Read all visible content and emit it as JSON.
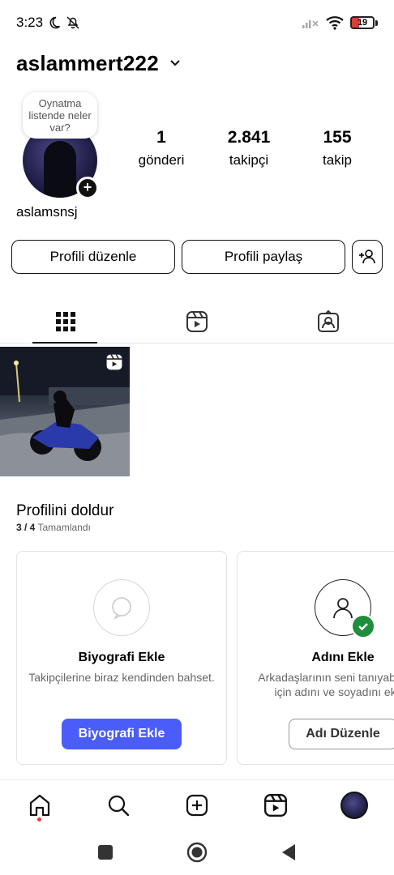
{
  "status_bar": {
    "time": "3:23",
    "battery": "19"
  },
  "header": {
    "username": "aslammert222"
  },
  "profile": {
    "note": "Oynatma listende neler var?",
    "display_name": "aslamsnsj",
    "stats": [
      {
        "value": "1",
        "label": "gönderi"
      },
      {
        "value": "2.841",
        "label": "takipçi"
      },
      {
        "value": "155",
        "label": "takip"
      }
    ]
  },
  "actions": {
    "edit_label": "Profili düzenle",
    "share_label": "Profili paylaş"
  },
  "complete_profile": {
    "title": "Profilini doldur",
    "progress": "3 / 4",
    "progress_label": "Tamamlandı",
    "cards": [
      {
        "title": "Biyografi Ekle",
        "text": "Takipçilerine biraz kendinden bahset.",
        "button": "Biyografi Ekle"
      },
      {
        "title": "Adını Ekle",
        "text": "Arkadaşlarının seni tanıyabilmesi için adını ve soyadını ekle.",
        "button": "Adı Düzenle"
      }
    ]
  },
  "colors": {
    "accent": "#4a5df9",
    "check": "#1e8e3e",
    "notification_dot": "#e53935"
  },
  "icons": {
    "tabs": [
      "grid-icon",
      "reels-icon",
      "tagged-icon"
    ],
    "nav": [
      "home-icon",
      "search-icon",
      "create-icon",
      "reels-icon",
      "profile-avatar"
    ]
  }
}
